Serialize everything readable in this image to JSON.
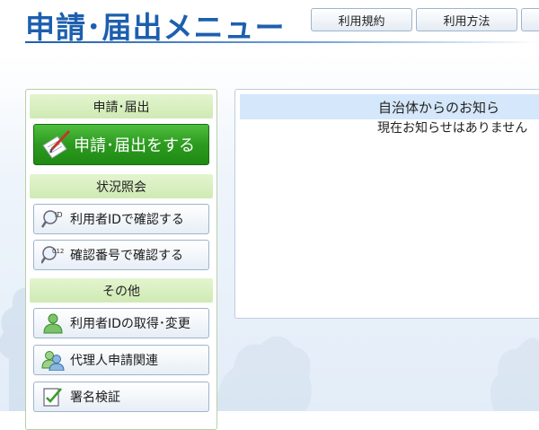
{
  "header": {
    "title": "申請･届出メニュー",
    "nav": [
      "利用規約",
      "利用方法",
      ""
    ]
  },
  "menu": {
    "sections": [
      {
        "label": "申請･届出"
      },
      {
        "label": "状況照会"
      },
      {
        "label": "その他"
      }
    ],
    "primary_button": {
      "label": "申請･届出をする",
      "icon": "pen-document-icon"
    },
    "status_buttons": [
      {
        "label": "利用者IDで確認する",
        "icon": "magnifier-id-icon",
        "icon_text": "ID"
      },
      {
        "label": "確認番号で確認する",
        "icon": "magnifier-012-icon",
        "icon_text": "012"
      }
    ],
    "other_buttons": [
      {
        "label": "利用者IDの取得･変更",
        "icon": "user-icon"
      },
      {
        "label": "代理人申請関連",
        "icon": "two-users-icon"
      },
      {
        "label": "署名検証",
        "icon": "signature-check-icon"
      }
    ]
  },
  "notice": {
    "title": "自治体からのお知ら",
    "body": "現在お知らせはありません"
  },
  "colors": {
    "title_blue": "#1d5fae",
    "section_green": "#d8efc1",
    "primary_green": "#2c9a1f",
    "notice_head": "#d5e7fa"
  }
}
